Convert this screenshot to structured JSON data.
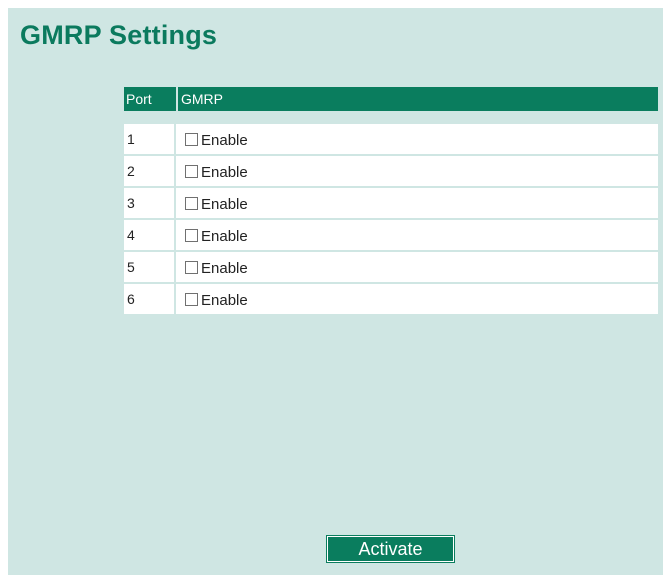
{
  "page": {
    "title": "GMRP Settings"
  },
  "table": {
    "headers": {
      "port": "Port",
      "gmrp": "GMRP"
    },
    "rows": [
      {
        "port": "1",
        "label": "Enable",
        "checked": false
      },
      {
        "port": "2",
        "label": "Enable",
        "checked": false
      },
      {
        "port": "3",
        "label": "Enable",
        "checked": false
      },
      {
        "port": "4",
        "label": "Enable",
        "checked": false
      },
      {
        "port": "5",
        "label": "Enable",
        "checked": false
      },
      {
        "port": "6",
        "label": "Enable",
        "checked": false
      }
    ]
  },
  "actions": {
    "activate_label": "Activate"
  },
  "colors": {
    "accent": "#0a7d5e",
    "title": "#0b7a5e",
    "panel_background": "#cfe6e3"
  }
}
